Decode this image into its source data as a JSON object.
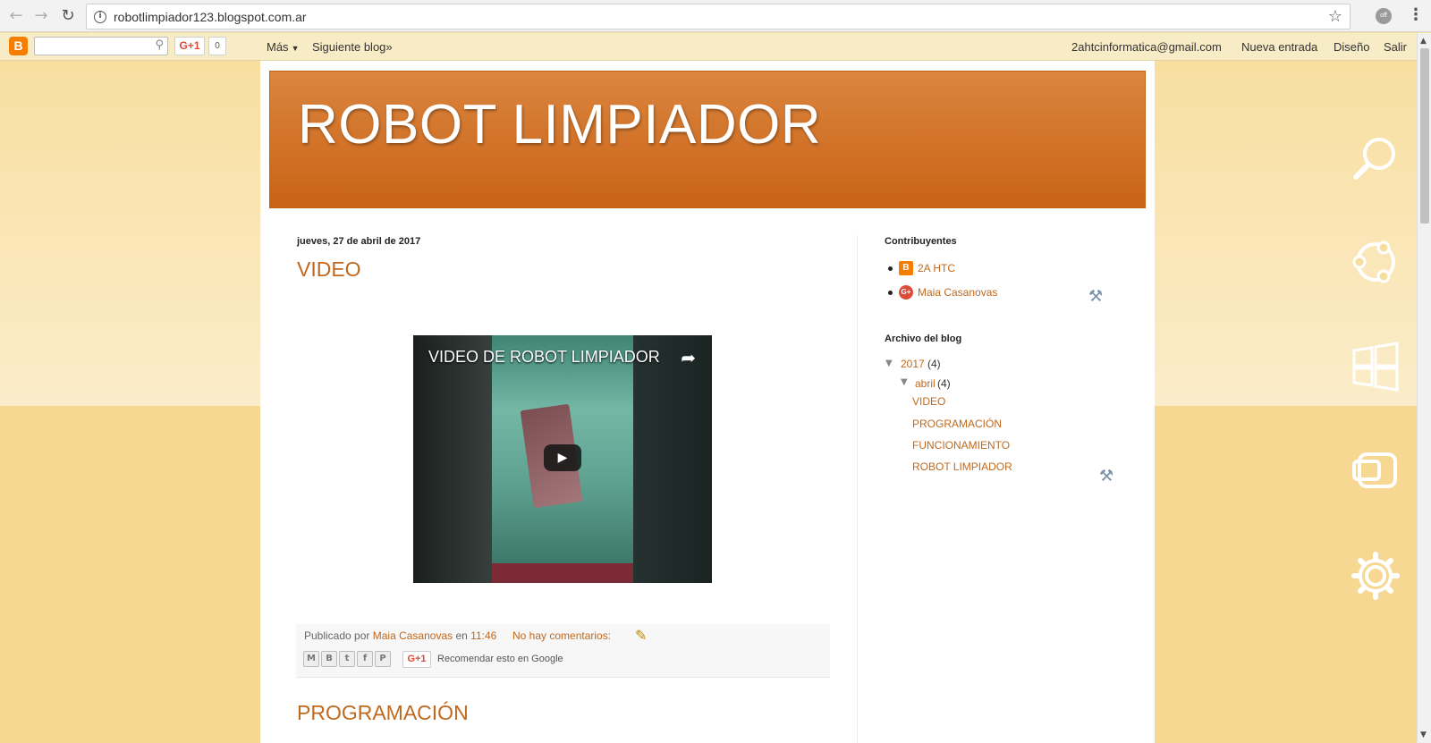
{
  "browser": {
    "url": "robotlimpiador123.blogspot.com.ar",
    "extension_label": "off"
  },
  "navbar": {
    "logo_letter": "B",
    "gplus_label": "G+1",
    "gplus_count": "0",
    "more_label": "Más",
    "next_blog_label": "Siguiente blog»",
    "email": "2ahtcinformatica@gmail.com",
    "new_post_label": "Nueva entrada",
    "design_label": "Diseño",
    "logout_label": "Salir"
  },
  "blog": {
    "title": "ROBOT LIMPIADOR"
  },
  "post": {
    "date": "jueves, 27 de abril de 2017",
    "title": "VIDEO",
    "video_title": "VIDEO DE ROBOT LIMPIADOR",
    "published_by_label": "Publicado por",
    "author": "Maia Casanovas",
    "at_label": "en",
    "time": "11:46",
    "comments_label": "No hay comentarios:",
    "recommend_label": "Recomendar esto en Google",
    "gplus_label": "G+1",
    "share_buttons": [
      "M",
      "B",
      "t",
      "f",
      "P"
    ]
  },
  "next_post": {
    "title": "PROGRAMACIÓN"
  },
  "sidebar": {
    "contributors_heading": "Contribuyentes",
    "contributors": [
      {
        "name": "2A HTC",
        "icon": "blogger-profile-icon",
        "icon_letter": "B",
        "color": "#f57d00"
      },
      {
        "name": "Maia Casanovas",
        "icon": "google-plus-profile-icon",
        "icon_letter": "G+",
        "color": "#dd4b39"
      }
    ],
    "archive_heading": "Archivo del blog",
    "archive": {
      "year": "2017",
      "year_count": "(4)",
      "month": "abril",
      "month_count": "(4)",
      "posts": [
        "VIDEO",
        "PROGRAMACIÓN",
        "FUNCIONAMIENTO",
        "ROBOT LIMPIADOR"
      ]
    }
  },
  "colors": {
    "link": "#c0691e",
    "header_top": "#db853f",
    "header_bottom": "#c96315",
    "background": "#f7dfa0"
  }
}
